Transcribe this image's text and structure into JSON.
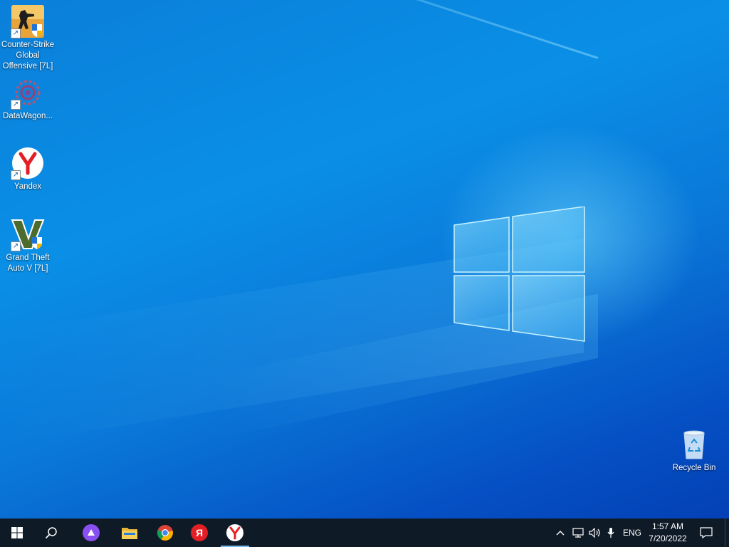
{
  "desktop": {
    "icons": [
      {
        "label": "Counter-Strike Global Offensive [7L]",
        "icon": "csgo-icon"
      },
      {
        "label": "DataWagon...",
        "icon": "datawagon-icon"
      },
      {
        "label": "Yandex",
        "icon": "yandex-browser-icon"
      },
      {
        "label": "Grand Theft Auto V [7L]",
        "icon": "gta-v-icon"
      },
      {
        "label": "Recycle Bin",
        "icon": "recycle-bin-icon"
      }
    ]
  },
  "taskbar": {
    "pinned": [
      {
        "name": "start",
        "icon": "windows-start-icon"
      },
      {
        "name": "search",
        "icon": "search-icon"
      },
      {
        "name": "alice",
        "icon": "alice-assistant-icon"
      },
      {
        "name": "file-explorer",
        "icon": "folder-icon"
      },
      {
        "name": "chrome",
        "icon": "chrome-icon"
      },
      {
        "name": "yandex-app",
        "icon": "yandex-letter-icon"
      },
      {
        "name": "yandex-browser",
        "icon": "yandex-browser-icon"
      }
    ],
    "tray": {
      "language": "ENG",
      "time": "1:57 AM",
      "date": "7/20/2022"
    }
  },
  "colors": {
    "taskbar": "#0f1a27",
    "accent": "#76b9ed",
    "yandex_red": "#e31e24"
  }
}
